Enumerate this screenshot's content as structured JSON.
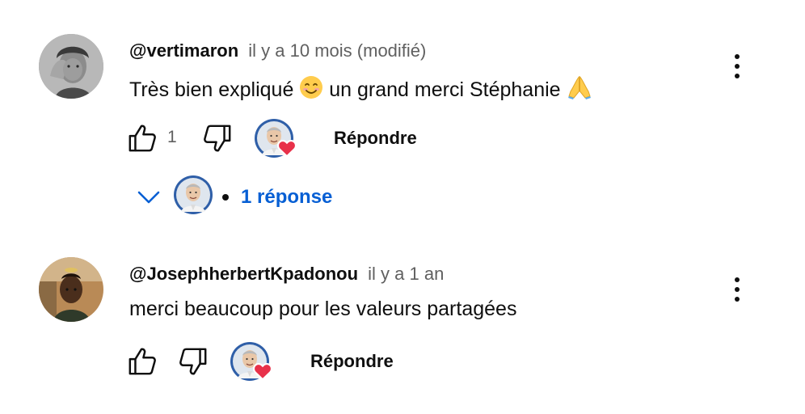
{
  "comments": [
    {
      "author": "@vertimaron",
      "meta": "il y a 10 mois (modifié)",
      "text_before": "Très bien expliqué",
      "text_after": "un grand merci Stéphanie",
      "emoji_1": "smiling-face-icon",
      "emoji_2": "folded-hands-icon",
      "like_count": "1",
      "reply_label": "Répondre",
      "replies_label": "1 réponse"
    },
    {
      "author": "@JosephherbertKpadonou",
      "meta": "il y a 1 an",
      "text": "merci beaucoup pour les valeurs partagées",
      "reply_label": "Répondre"
    }
  ],
  "colors": {
    "link_blue": "#065fd4",
    "meta_grey": "#606060",
    "heart_red": "#e8314a"
  }
}
